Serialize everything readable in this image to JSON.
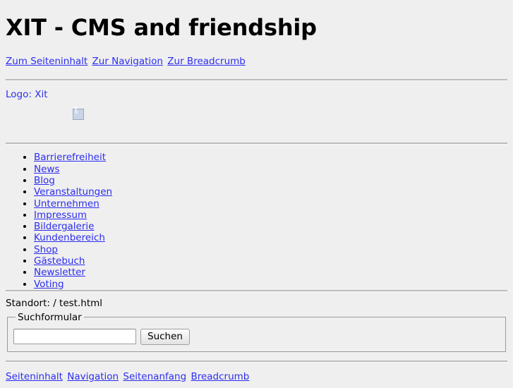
{
  "page": {
    "title": "XIT - CMS and friendship",
    "location_label": "Standort: / test.html"
  },
  "skip_links": [
    {
      "label": "Zum Seiteninhalt"
    },
    {
      "label": "Zur Navigation"
    },
    {
      "label": "Zur Breadcrumb"
    }
  ],
  "logo": {
    "label": "Logo: Xit"
  },
  "banner": {
    "image_alt": "broken-image-placeholder"
  },
  "navigation": {
    "items": [
      {
        "label": "Barrierefreiheit"
      },
      {
        "label": "News"
      },
      {
        "label": "Blog"
      },
      {
        "label": "Veranstaltungen"
      },
      {
        "label": "Unternehmen"
      },
      {
        "label": "Impressum"
      },
      {
        "label": "Bildergalerie"
      },
      {
        "label": "Kundenbereich"
      },
      {
        "label": "Shop"
      },
      {
        "label": "Gästebuch"
      },
      {
        "label": "Newsletter"
      },
      {
        "label": "Voting"
      }
    ]
  },
  "search_form": {
    "legend": "Suchformular",
    "input_value": "",
    "input_placeholder": "",
    "submit_label": "Suchen"
  },
  "footer_links": [
    {
      "label": "Seiteninhalt"
    },
    {
      "label": "Navigation"
    },
    {
      "label": "Seitenanfang"
    },
    {
      "label": "Breadcrumb"
    }
  ],
  "colors": {
    "background": "#efefef",
    "link": "#2d2df0",
    "rule": "#bcbcbc",
    "text": "#000000"
  }
}
